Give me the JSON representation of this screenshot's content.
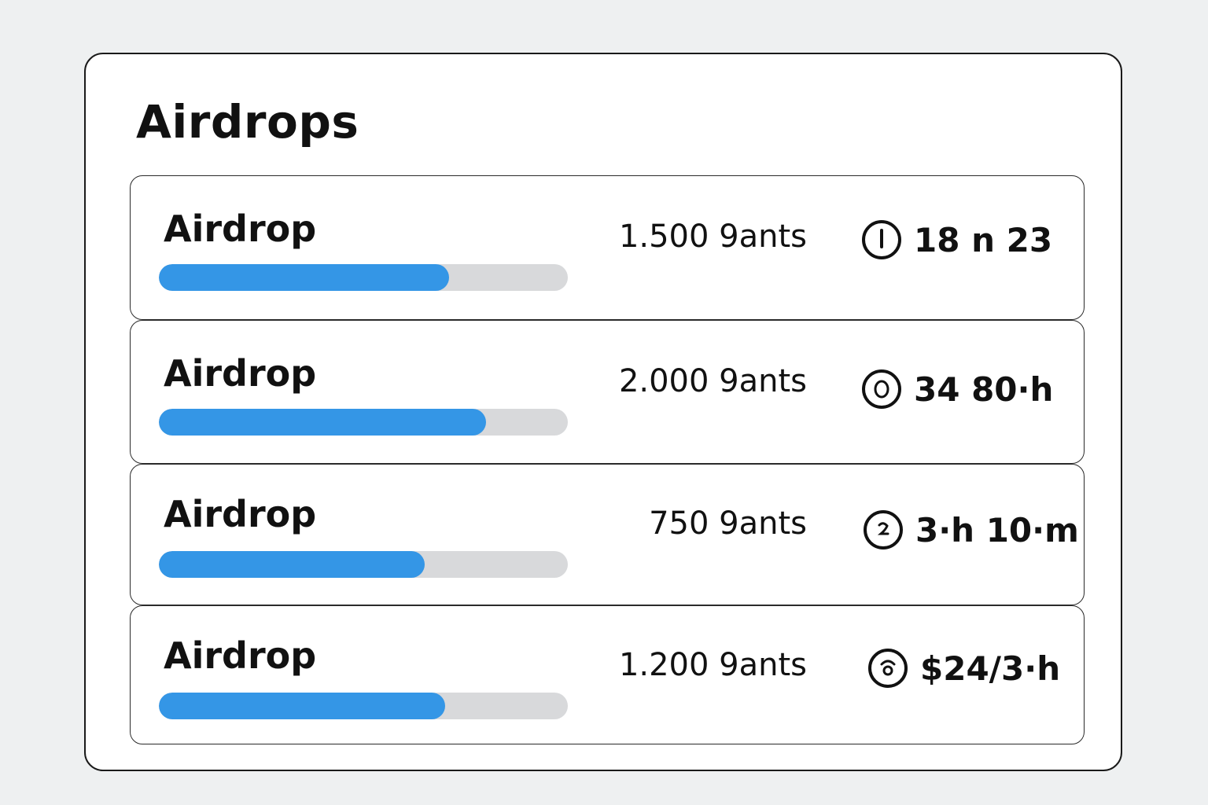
{
  "panel": {
    "title": "Airdrops"
  },
  "airdrops": [
    {
      "name": "Airdrop",
      "points": "1.500 9ants",
      "progress": 0.71,
      "time_left": "18 n 23",
      "icon": "clock-icon"
    },
    {
      "name": "Airdrop",
      "points": "2.000 9ants",
      "progress": 0.8,
      "time_left": "34 80·h",
      "icon": "clock-icon"
    },
    {
      "name": "Airdrop",
      "points": "750 9ants",
      "progress": 0.65,
      "time_left": "3·h 10·m",
      "icon": "clock-icon"
    },
    {
      "name": "Airdrop",
      "points": "1.200 9ants",
      "progress": 0.7,
      "time_left": "$24/3·h",
      "icon": "clock-icon"
    }
  ],
  "colors": {
    "progress_fill": "#3496e6",
    "progress_track": "#d8d9db",
    "background": "#eef0f1"
  }
}
